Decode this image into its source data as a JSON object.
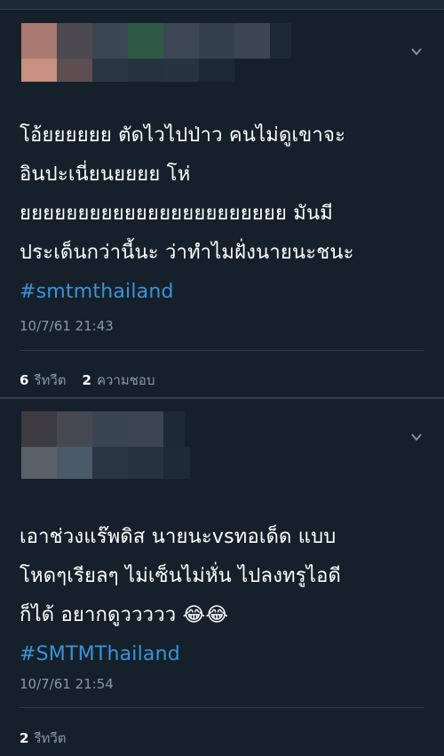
{
  "tweets": [
    {
      "text_lines": [
        "โอ้ยยยยยย ตัดไวไปป่าว คนไม่ดูเขาจะ",
        "อินปะเนี่ยนยยยย โห่",
        "ยยยยยยยยยยยยยยยยยยยยยยย มันมี",
        "ประเด็นกว่านี้นะ ว่าทำไมฝั่งนายนะชนะ"
      ],
      "hashtag": "#smtmthailand",
      "timestamp": "10/7/61 21:43",
      "retweets_count": "6",
      "retweets_label": "รีทวีต",
      "likes_count": "2",
      "likes_label": "ความชอบ"
    },
    {
      "text_lines": [
        "เอาช่วงแร๊พดิส นายนะvsทอเด็ด แบบ",
        "โหดๆเรียลๆ ไม่เซ็นไม่หั่น ไปลงทรูไอดี",
        "ก็ได้ อยากดูววววว 😂😂"
      ],
      "hashtag": "#SMTMThailand",
      "timestamp": "10/7/61 21:54",
      "retweets_count": "2",
      "retweets_label": "รีทวีต"
    }
  ],
  "icons": {
    "chevron": "chevron-down-icon"
  },
  "colors": {
    "background": "#15202b",
    "hashtag": "#3a93d8",
    "muted": "#8899a6"
  }
}
